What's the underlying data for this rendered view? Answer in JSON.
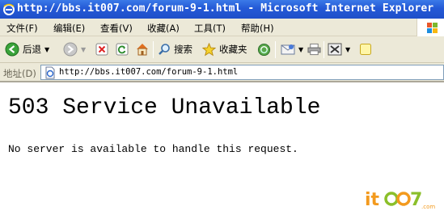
{
  "window": {
    "title": "http://bbs.it007.com/forum-9-1.html - Microsoft Internet Explorer"
  },
  "menu": {
    "items": [
      "文件(F)",
      "编辑(E)",
      "查看(V)",
      "收藏(A)",
      "工具(T)",
      "帮助(H)"
    ]
  },
  "toolbar": {
    "back_label": "后退",
    "search_label": "搜索",
    "favorites_label": "收藏夹"
  },
  "address": {
    "label": "地址(D)",
    "url": "http://bbs.it007.com/forum-9-1.html"
  },
  "page": {
    "heading": "503 Service Unavailable",
    "message": "No server is available to handle this request."
  },
  "watermark": {
    "text": "itoo7.com"
  },
  "colors": {
    "titlebar": "#2459d6",
    "chrome": "#ece9d8",
    "watermark_orange": "#f39a1e",
    "watermark_green": "#8bbf2a"
  }
}
